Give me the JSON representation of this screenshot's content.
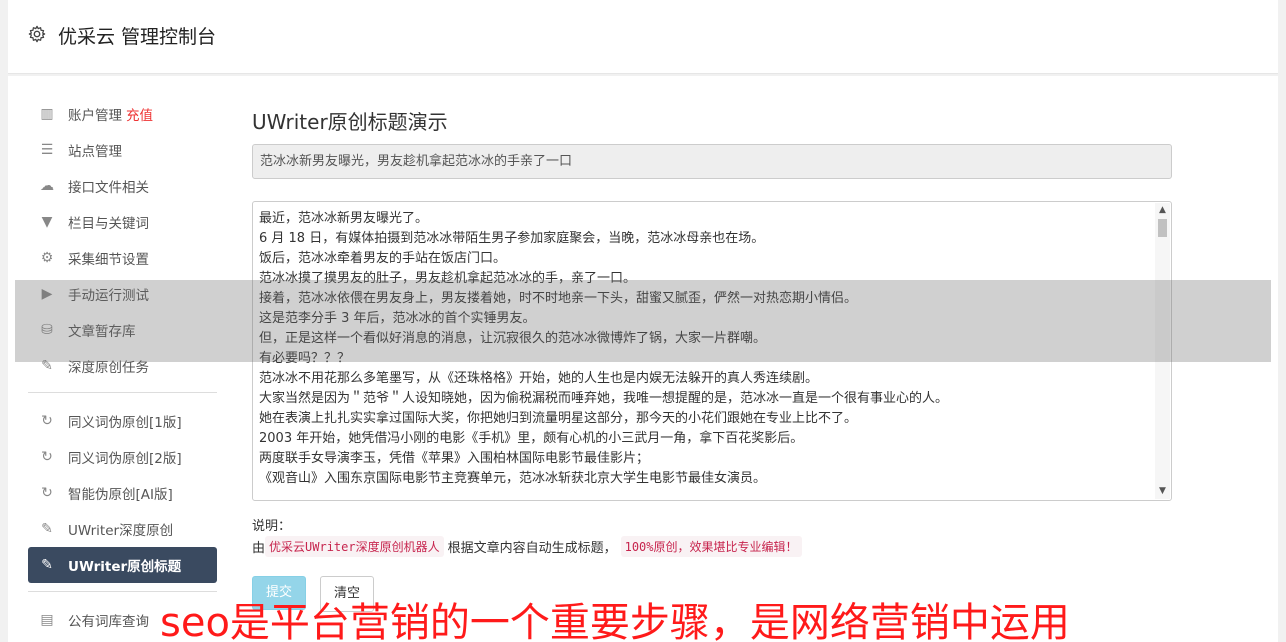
{
  "header": {
    "title": "优采云 管理控制台",
    "icon": "gear-icon"
  },
  "sidebar": {
    "group1": [
      {
        "icon": "bar-chart-icon",
        "label": "账户管理",
        "badge": "充值"
      },
      {
        "icon": "server-icon",
        "label": "站点管理"
      },
      {
        "icon": "cloud-upload-icon",
        "label": "接口文件相关"
      },
      {
        "icon": "filter-icon",
        "label": "栏目与关键词"
      },
      {
        "icon": "cogs-icon",
        "label": "采集细节设置"
      },
      {
        "icon": "play-circle-icon",
        "label": "手动运行测试"
      },
      {
        "icon": "database-icon",
        "label": "文章暂存库"
      },
      {
        "icon": "edit-icon",
        "label": "深度原创任务"
      }
    ],
    "group2": [
      {
        "icon": "refresh-icon",
        "label": "同义词伪原创[1版]"
      },
      {
        "icon": "refresh-icon",
        "label": "同义词伪原创[2版]"
      },
      {
        "icon": "refresh-icon",
        "label": "智能伪原创[AI版]"
      },
      {
        "icon": "edit-icon",
        "label": "UWriter深度原创"
      },
      {
        "icon": "edit-icon",
        "label": "UWriter原创标题",
        "active": true
      }
    ],
    "group3": [
      {
        "icon": "book-icon",
        "label": "公有词库查询"
      }
    ]
  },
  "main": {
    "heading": "UWriter原创标题演示",
    "generated_title": "范冰冰新男友曝光，男友趁机拿起范冰冰的手亲了一口",
    "article_lines": [
      "最近，范冰冰新男友曝光了。",
      "6 月 18 日，有媒体拍摄到范冰冰带陌生男子参加家庭聚会，当晚，范冰冰母亲也在场。",
      "饭后，范冰冰牵着男友的手站在饭店门口。",
      "范冰冰摸了摸男友的肚子，男友趁机拿起范冰冰的手，亲了一口。",
      "接着，范冰冰依偎在男友身上，男友搂着她，时不时地亲一下头，甜蜜又腻歪，俨然一对热恋期小情侣。",
      "这是范李分手 3 年后，范冰冰的首个实锤男友。",
      "但，正是这样一个看似好消息的消息，让沉寂很久的范冰冰微博炸了锅，大家一片群嘲。",
      "有必要吗？？？",
      "范冰冰不用花那么多笔墨写，从《还珠格格》开始，她的人生也是内娱无法躲开的真人秀连续剧。",
      "大家当然是因为＂范爷＂人设知晓她，因为偷税漏税而唾弃她，我唯一想提醒的是，范冰冰一直是一个很有事业心的人。",
      "她在表演上扎扎实实拿过国际大奖，你把她归到流量明星这部分，那今天的小花们跟她在专业上比不了。",
      "2003 年开始，她凭借冯小刚的电影《手机》里，颇有心机的小三武月一角，拿下百花奖影后。",
      "两度联手女导演李玉，凭借《苹果》入围柏林国际电影节最佳影片；",
      "《观音山》入围东京国际电影节主竞赛单元，范冰冰斩获北京大学生电影节最佳女演员。"
    ],
    "note_label": "说明：",
    "note_prefix": "由",
    "note_code1": "优采云UWriter深度原创机器人",
    "note_middle": "根据文章内容自动生成标题，",
    "note_code2": "100%原创，效果堪比专业编辑！",
    "submit_label": "提交",
    "clear_label": "清空"
  },
  "watermark": "seo是平台营销的一个重要步骤，是网络营销中运用",
  "colors": {
    "accent_active": "#3a4a60",
    "recharge": "#ee3333",
    "watermark": "#ff1a1a",
    "submit": "#5bc0de"
  }
}
